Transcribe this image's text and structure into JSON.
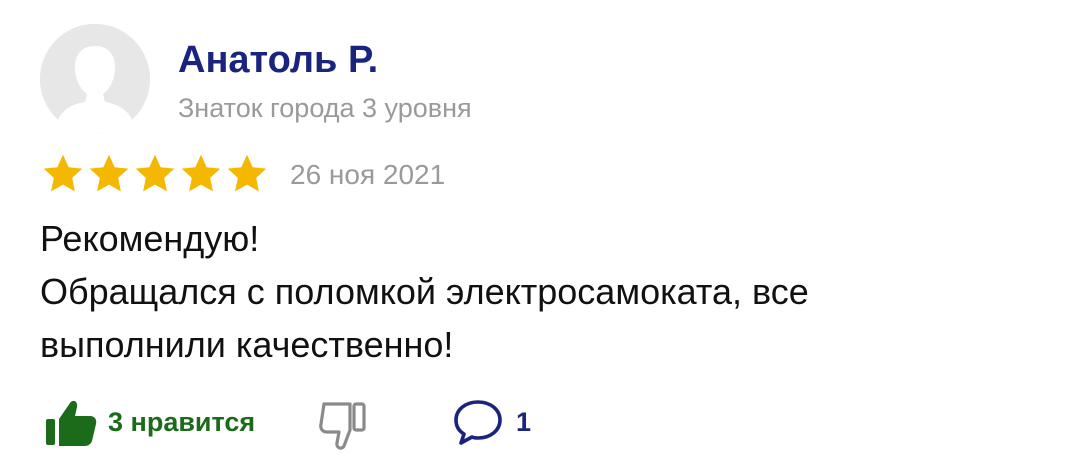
{
  "review": {
    "author": {
      "name": "Анатоль Р.",
      "level": "Знаток города 3 уровня"
    },
    "rating": 5,
    "date": "26 ноя 2021",
    "text_lines": [
      "Рекомендую!",
      "Обращался с поломкой электросамоката, все",
      "выполнили качественно!"
    ],
    "actions": {
      "like_label": "3 нравится",
      "comment_count": "1"
    }
  },
  "colors": {
    "author_name": "#1a237e",
    "secondary_text": "#9a9a9a",
    "star": "#f5b800",
    "like": "#1b6b1b",
    "dislike": "#8a8a8a",
    "comment": "#1a237e"
  },
  "icons": [
    "avatar-placeholder-icon",
    "star-icon",
    "thumbs-up-icon",
    "thumbs-down-icon",
    "comment-icon"
  ]
}
